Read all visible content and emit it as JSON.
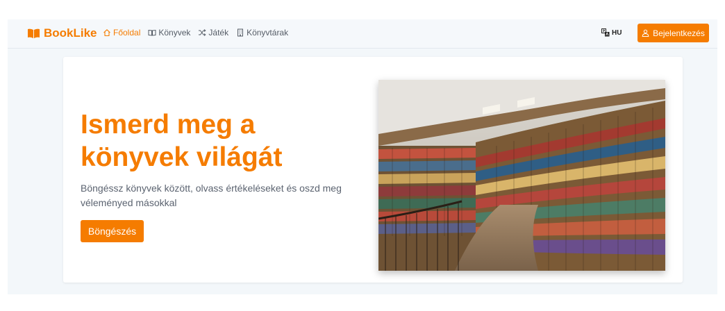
{
  "brand": {
    "name": "BookLike"
  },
  "nav": {
    "items": [
      {
        "label": "Főoldal",
        "icon": "home-icon",
        "active": true
      },
      {
        "label": "Könyvek",
        "icon": "book-open-icon",
        "active": false
      },
      {
        "label": "Játék",
        "icon": "shuffle-icon",
        "active": false
      },
      {
        "label": "Könyvtárak",
        "icon": "building-icon",
        "active": false
      }
    ]
  },
  "language": {
    "code": "HU",
    "icon": "translate-icon"
  },
  "login": {
    "label": "Bejelentkezés",
    "icon": "user-icon"
  },
  "hero": {
    "title_line1": "Ismerd meg a",
    "title_line2": "könyvek világát",
    "subtitle": "Böngéssz könyvek között, olvass értékeléseket és oszd meg véleményed másokkal",
    "button_label": "Böngészés",
    "image": "library-bookshelves-photo"
  },
  "colors": {
    "accent": "#f57c00",
    "nav_background": "#f5f8fb",
    "page_background": "#f3f7fa",
    "text_muted": "#5b6370"
  }
}
